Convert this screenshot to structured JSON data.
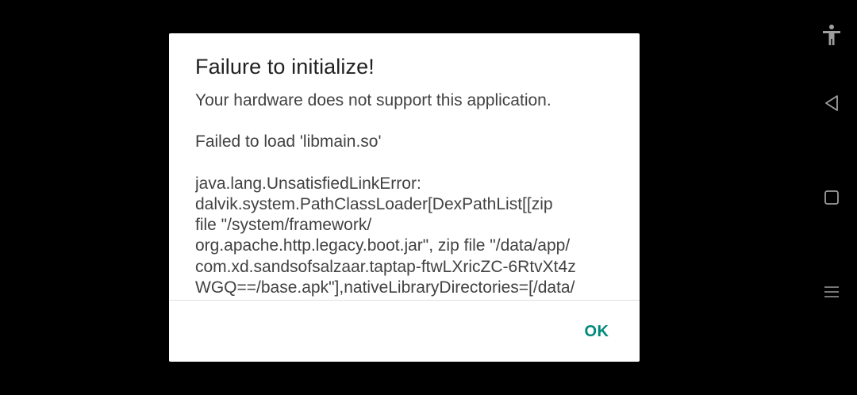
{
  "dialog": {
    "title": "Failure to initialize!",
    "message": "Your hardware does not support this application.",
    "detail": "Failed to load 'libmain.so'",
    "error_lines": [
      "java.lang.UnsatisfiedLinkError:",
      "dalvik.system.PathClassLoader[DexPathList[[zip",
      "file \"/system/framework/",
      "org.apache.http.legacy.boot.jar\", zip file \"/data/app/",
      "com.xd.sandsofsalzaar.taptap-ftwLXricZC-6RtvXt4z",
      "WGQ==/base.apk\"],nativeLibraryDirectories=[/data/"
    ],
    "ok_label": "OK"
  },
  "nav_bar": {
    "icons": [
      "accessibility-icon",
      "back-icon",
      "recents-icon",
      "menu-icon"
    ]
  },
  "colors": {
    "background": "#000000",
    "dialog": "#ffffff",
    "accent": "#00897b",
    "title_text": "#212121",
    "body_text": "#424242",
    "nav_icon": "#9e9e9e"
  }
}
